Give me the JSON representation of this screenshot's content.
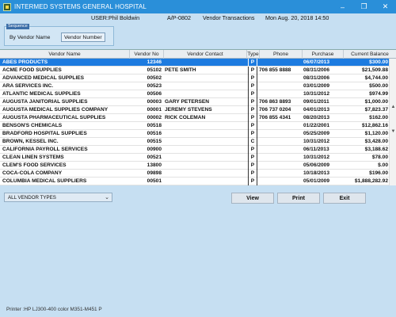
{
  "window": {
    "title": "INTERMED SYSTEMS GENERAL HOSPITAL",
    "minimize_glyph": "–",
    "maximize_glyph": "❐",
    "close_glyph": "✕"
  },
  "header": {
    "user": "USER:Phil Boldwin",
    "module": "A/P-0802",
    "screen_title": "Vendor Transactions",
    "datetime": "Mon Aug. 20, 2018 14:50"
  },
  "sequence": {
    "label": "Sequence",
    "options": [
      "By Vendor Name",
      "Vendor Number"
    ],
    "selected": "Vendor Number"
  },
  "grid": {
    "columns": [
      "Vendor Name",
      "Vendor No",
      "Vendor Contact",
      "Type",
      "Phone",
      "Purchase",
      "Current Balance"
    ],
    "rows": [
      {
        "name": "ABES PRODUCTS",
        "no": "12346",
        "contact": "",
        "type": "P",
        "phone": "",
        "purchase": "06/07/2013",
        "balance": "$300.00"
      },
      {
        "name": "ACME FOOD SUPPLIES",
        "no": "05102",
        "contact": "PETE SMITH",
        "type": "P",
        "phone": "706 855 8888",
        "purchase": "08/31/2006",
        "balance": "$21,509.88"
      },
      {
        "name": "ADVANCED MEDICAL SUPPLIES",
        "no": "00502",
        "contact": "",
        "type": "P",
        "phone": "",
        "purchase": "08/31/2006",
        "balance": "$4,744.00"
      },
      {
        "name": "ARA SERVICES INC.",
        "no": "00523",
        "contact": "",
        "type": "P",
        "phone": "",
        "purchase": "03/01/2009",
        "balance": "$500.00"
      },
      {
        "name": "ATLANTIC MEDICAL SUPPLIES",
        "no": "00506",
        "contact": "",
        "type": "P",
        "phone": "",
        "purchase": "10/31/2012",
        "balance": "$974.99"
      },
      {
        "name": "AUGUSTA JANITORIAL SUPPLIES",
        "no": "00003",
        "contact": "GARY PETERSEN",
        "type": "P",
        "phone": "706 863 8893",
        "purchase": "09/01/2011",
        "balance": "$1,000.00"
      },
      {
        "name": "AUGUSTA MEDICAL SUPPLIES COMPANY",
        "no": "00001",
        "contact": "JEREMY STEVENS",
        "type": "P",
        "phone": "706 737 0204",
        "purchase": "04/01/2013",
        "balance": "$7,823.37"
      },
      {
        "name": "AUGUSTA PHARMACEUTICAL SUPPLIES",
        "no": "00002",
        "contact": "RICK COLEMAN",
        "type": "P",
        "phone": "706 855 4341",
        "purchase": "08/20/2013",
        "balance": "$162.00"
      },
      {
        "name": "BENSON'S CHEMICALS",
        "no": "00518",
        "contact": "",
        "type": "P",
        "phone": "",
        "purchase": "01/22/2001",
        "balance": "$12,862.16"
      },
      {
        "name": "BRADFORD HOSPITAL SUPPLIES",
        "no": "00516",
        "contact": "",
        "type": "P",
        "phone": "",
        "purchase": "05/25/2009",
        "balance": "$1,120.00"
      },
      {
        "name": "BROWN, KESSEL INC.",
        "no": "00515",
        "contact": "",
        "type": "C",
        "phone": "",
        "purchase": "10/31/2012",
        "balance": "$3,428.00"
      },
      {
        "name": "CALIFORNIA PAYROLL SERVICES",
        "no": "00900",
        "contact": "",
        "type": "P",
        "phone": "",
        "purchase": "06/11/2013",
        "balance": "$3,188.62"
      },
      {
        "name": "CLEAN LINEN SYSTEMS",
        "no": "00521",
        "contact": "",
        "type": "P",
        "phone": "",
        "purchase": "10/31/2012",
        "balance": "$78.00"
      },
      {
        "name": "CLEM'S FOOD SERVICES",
        "no": "13800",
        "contact": "",
        "type": "P",
        "phone": "",
        "purchase": "05/06/2009",
        "balance": "$.00"
      },
      {
        "name": "COCA-COLA COMPANY",
        "no": "09898",
        "contact": "",
        "type": "P",
        "phone": "",
        "purchase": "10/18/2013",
        "balance": "$196.00"
      },
      {
        "name": "COLUMBIA MEDICAL SUPPLIERS",
        "no": "00501",
        "contact": "",
        "type": "P",
        "phone": "",
        "purchase": "05/01/2009",
        "balance": "$1,888,282.92"
      }
    ],
    "selected_index": 0
  },
  "filter": {
    "value": "ALL VENDOR TYPES",
    "arrow": "⌄"
  },
  "buttons": {
    "view": "View",
    "print": "Print",
    "exit": "Exit"
  },
  "status": {
    "printer": "Printer :HP LJ300-400 color M351-M451 P"
  },
  "colors": {
    "titlebar": "#2a8fd9",
    "selected_row": "#1d7be0",
    "background": "#c6dff2"
  }
}
